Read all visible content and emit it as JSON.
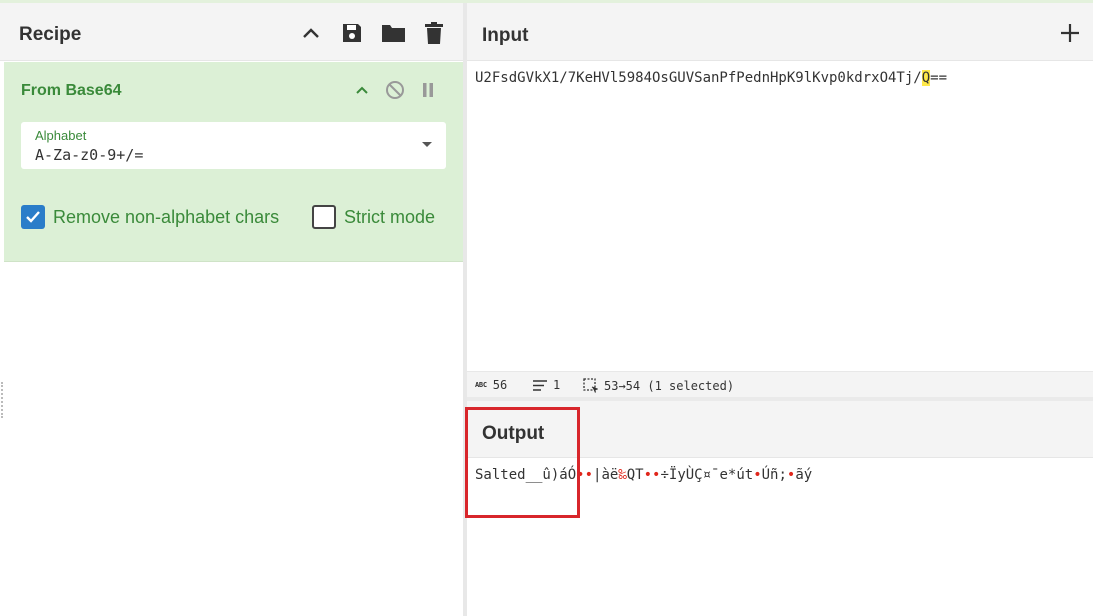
{
  "recipe": {
    "title": "Recipe",
    "buttons": {
      "collapse": "chevron-up-icon",
      "save": "save-icon",
      "load": "folder-icon",
      "clear": "trash-icon"
    },
    "operation": {
      "name": "From Base64",
      "alphabet_label": "Alphabet",
      "alphabet_value": "A-Za-z0-9+/=",
      "remove_non_alphabet_label": "Remove non-alphabet chars",
      "remove_non_alphabet_checked": true,
      "strict_mode_label": "Strict mode",
      "strict_mode_checked": false
    }
  },
  "input": {
    "title": "Input",
    "text_before": "U2FsdGVkX1/7KeHVl5984OsGUVSanPfPednHpK9lKvp0kdrxO4Tj/",
    "text_selected": "Q",
    "text_after": "=="
  },
  "status": {
    "length": "56",
    "lines": "1",
    "selection": "53→54 (1 selected)"
  },
  "output": {
    "title": "Output",
    "seg1": "Salted__û)áÓ",
    "seg2": "••",
    "seg3": "|àë",
    "seg4": "‰",
    "seg5": "QT",
    "seg6": "••",
    "seg7": "÷ÏyÙÇ¤¯e*út",
    "seg8": "•",
    "seg9": "Úñ;",
    "seg10": "•",
    "seg11": "ãý"
  },
  "colors": {
    "operation_bg": "#dcf0d6",
    "operation_text": "#3a8a3a",
    "checkbox": "#2a7dc9",
    "highlight": "#ffe94a",
    "annotation": "#d8262b"
  }
}
